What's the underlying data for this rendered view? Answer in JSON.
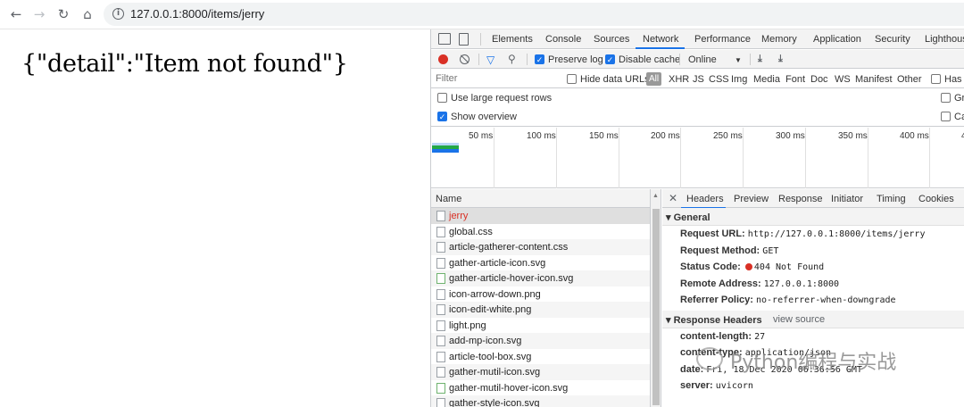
{
  "browser": {
    "back_icon": "arrow-left-icon",
    "forward_icon": "arrow-right-icon",
    "reload_icon": "reload-icon",
    "home_icon": "home-icon",
    "url": "127.0.0.1:8000/items/jerry"
  },
  "page": {
    "json_text": "{\"detail\":\"Item not found\"}"
  },
  "devtools": {
    "tabs": [
      "Elements",
      "Console",
      "Sources",
      "Network",
      "Performance",
      "Memory",
      "Application",
      "Security",
      "Lighthous"
    ],
    "active_tab": "Network",
    "network_toolbar": {
      "preserve_log": "Preserve log",
      "disable_cache": "Disable cache",
      "throttle": "Online"
    },
    "filter": {
      "placeholder": "Filter",
      "hide_data_urls": "Hide data URLs",
      "all": "All",
      "types": [
        "XHR",
        "JS",
        "CSS",
        "Img",
        "Media",
        "Font",
        "Doc",
        "WS",
        "Manifest",
        "Other"
      ],
      "has_blocked": "Has b"
    },
    "options": {
      "large_rows": "Use large request rows",
      "show_overview": "Show overview",
      "group": "Gr",
      "capture": "Ca"
    },
    "timeline_ticks": [
      "50 ms",
      "100 ms",
      "150 ms",
      "200 ms",
      "250 ms",
      "300 ms",
      "350 ms",
      "400 ms",
      "4"
    ],
    "name_header": "Name",
    "requests": [
      "jerry",
      "global.css",
      "article-gatherer-content.css",
      "gather-article-icon.svg",
      "gather-article-hover-icon.svg",
      "icon-arrow-down.png",
      "icon-edit-white.png",
      "light.png",
      "add-mp-icon.svg",
      "article-tool-box.svg",
      "gather-mutil-icon.svg",
      "gather-mutil-hover-icon.svg",
      "gather-style-icon.svg"
    ],
    "detail_tabs": [
      "Headers",
      "Preview",
      "Response",
      "Initiator",
      "Timing",
      "Cookies"
    ],
    "general_title": "General",
    "general": [
      {
        "k": "Request URL:",
        "v": "http://127.0.0.1:8000/items/jerry"
      },
      {
        "k": "Request Method:",
        "v": "GET"
      },
      {
        "k": "Status Code:",
        "v": "404 Not Found"
      },
      {
        "k": "Remote Address:",
        "v": "127.0.0.1:8000"
      },
      {
        "k": "Referrer Policy:",
        "v": "no-referrer-when-downgrade"
      }
    ],
    "response_headers_title": "Response Headers",
    "view_source": "view source",
    "response_headers": [
      {
        "k": "content-length:",
        "v": "27"
      },
      {
        "k": "content-type:",
        "v": "application/json"
      },
      {
        "k": "date:",
        "v": "Fri, 18 Dec 2020 06:36:56 GMT"
      },
      {
        "k": "server:",
        "v": "uvicorn"
      }
    ]
  },
  "watermark": "Python编程与实战",
  "colors": {
    "accent": "#1a73e8",
    "error": "#d93025"
  }
}
